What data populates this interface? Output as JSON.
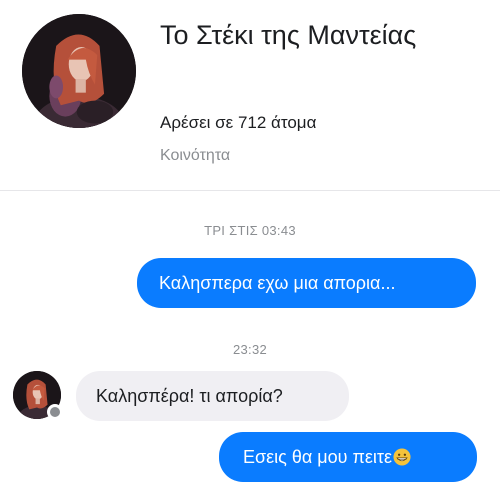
{
  "page": {
    "title": "Το Στέκι της Μαντείας",
    "likes": "Αρέσει σε 712 άτομα",
    "category": "Κοινότητα"
  },
  "conversation": {
    "timestamps": [
      "ΤΡΙ ΣΤΙΣ 03:43",
      "23:32"
    ],
    "messages": [
      {
        "direction": "outgoing",
        "text": "Καλησπερα εχω μια απορια..."
      },
      {
        "direction": "incoming",
        "text": "Καλησπέρα! τι απορία?"
      },
      {
        "direction": "outgoing",
        "text": "Εσεις θα μου πειτε",
        "emoji": "grinning-face-icon"
      }
    ]
  },
  "colors": {
    "outgoing_bubble": "#0a7cff",
    "incoming_bubble": "#f0eff3",
    "secondary_text": "#8a8d91"
  }
}
